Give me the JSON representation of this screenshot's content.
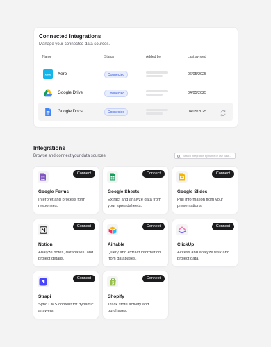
{
  "connected": {
    "title": "Connected integrations",
    "subtitle": "Manage your connected data sources.",
    "columns": {
      "name": "Name",
      "status": "Status",
      "added_by": "Added by",
      "last_synced": "Last synced"
    },
    "rows": [
      {
        "name": "Xero",
        "icon": "xero-icon",
        "status": "Connected",
        "last_synced": "06/05/2025"
      },
      {
        "name": "Google Drive",
        "icon": "google-drive-icon",
        "status": "Connected",
        "last_synced": "04/05/2025"
      },
      {
        "name": "Google Docs",
        "icon": "google-docs-icon",
        "status": "Connected",
        "last_synced": "04/05/2025",
        "hovered": true
      }
    ]
  },
  "integrations": {
    "title": "Integrations",
    "subtitle": "Browse and connect your data sources.",
    "search_placeholder": "Search integration by name or use case...",
    "connect_label": "Connect",
    "items": [
      {
        "name": "Google Forms",
        "icon": "google-forms-icon",
        "description": "Interpret and process form responses."
      },
      {
        "name": "Google Sheets",
        "icon": "google-sheets-icon",
        "description": "Extract and analyze data from your spreadsheets."
      },
      {
        "name": "Google Slides",
        "icon": "google-slides-icon",
        "description": "Pull information from your presentations."
      },
      {
        "name": "Notion",
        "icon": "notion-icon",
        "description": "Analyze notes, databases, and project details."
      },
      {
        "name": "Airtable",
        "icon": "airtable-icon",
        "description": "Query and extract information from databases."
      },
      {
        "name": "ClickUp",
        "icon": "clickup-icon",
        "description": "Access and analyze task and project data."
      },
      {
        "name": "Strapi",
        "icon": "strapi-icon",
        "description": "Sync CMS content for dynamic answers."
      },
      {
        "name": "Shopify",
        "icon": "shopify-icon",
        "description": "Track store activity and purchases."
      }
    ]
  },
  "colors": {
    "background": "#f3f3f4",
    "connect_button": "#1c1c1e",
    "status_text": "#3b5bdb",
    "status_bg": "#e7edfd"
  }
}
